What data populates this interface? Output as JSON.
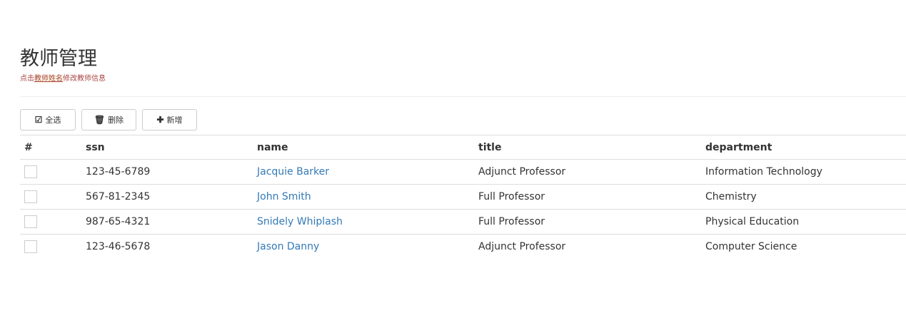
{
  "header": {
    "title": "教师管理",
    "subtitle_prefix": "点击",
    "subtitle_highlight": "教师姓名",
    "subtitle_suffix": "修改教师信息"
  },
  "toolbar": {
    "select_all_label": "全选",
    "delete_label": "删除",
    "add_label": "新增"
  },
  "table": {
    "columns": [
      "#",
      "ssn",
      "name",
      "title",
      "department"
    ],
    "rows": [
      {
        "ssn": "123-45-6789",
        "name": "Jacquie Barker",
        "title": "Adjunct Professor",
        "department": "Information Technology"
      },
      {
        "ssn": "567-81-2345",
        "name": "John Smith",
        "title": "Full Professor",
        "department": "Chemistry"
      },
      {
        "ssn": "987-65-4321",
        "name": "Snidely Whiplash",
        "title": "Full Professor",
        "department": "Physical Education"
      },
      {
        "ssn": "123-46-5678",
        "name": "Jason Danny",
        "title": "Adjunct Professor",
        "department": "Computer Science"
      }
    ]
  },
  "colors": {
    "link": "#337ab7",
    "subtitle": "#a94442",
    "highlight_bg": "#fcf8e3"
  }
}
